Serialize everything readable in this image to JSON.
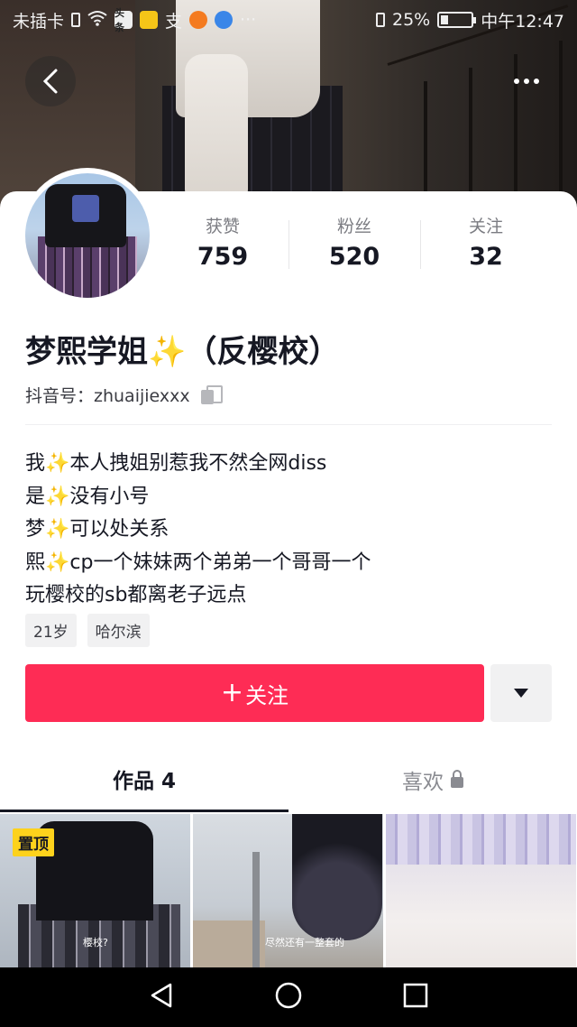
{
  "status_bar": {
    "carrier": "未插卡",
    "app_badge": "头条",
    "alipay": "支",
    "battery_percent": "25%",
    "battery_level": 0.25,
    "time": "中午12:47",
    "more": "···"
  },
  "profile": {
    "name": "梦熙学姐✨（反樱校）",
    "douyin_id": "抖音号：zhuaijiexxx",
    "stats": [
      {
        "label": "获赞",
        "value": "759"
      },
      {
        "label": "粉丝",
        "value": "520"
      },
      {
        "label": "关注",
        "value": "32"
      }
    ],
    "bio": [
      "我✨本人拽姐别惹我不然全网diss",
      "是✨没有小号",
      "梦✨可以处关系",
      "熙✨cp一个妹妹两个弟弟一个哥哥一个",
      "玩樱校的sb都离老子远点"
    ],
    "tags": [
      "21岁",
      "哈尔滨"
    ]
  },
  "actions": {
    "follow_plus": "+",
    "follow_label": "关注"
  },
  "tabs": {
    "works": "作品 4",
    "likes": "喜欢"
  },
  "videos": [
    {
      "pinned_label": "置顶",
      "caption": "樱校?"
    },
    {
      "caption": "尽然还有一整套的"
    },
    {
      "caption": ""
    }
  ],
  "colors": {
    "accent": "#fe2c55",
    "pin": "#fdd21c",
    "text": "#161823",
    "muted": "#7b7c82"
  }
}
